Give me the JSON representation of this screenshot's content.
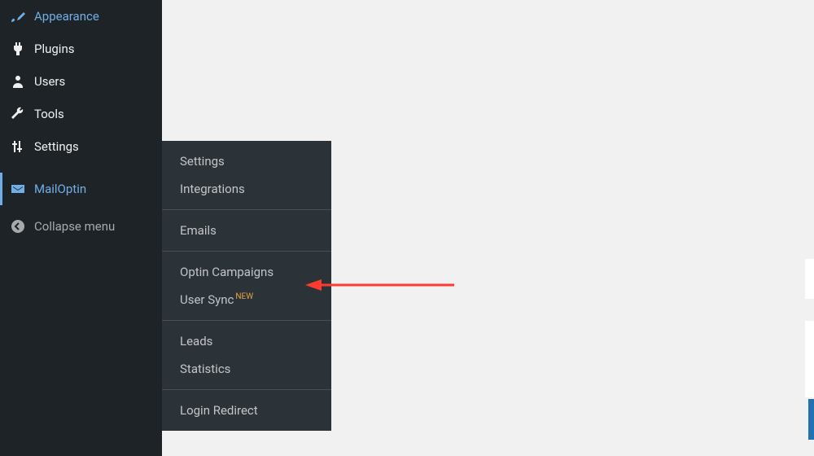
{
  "sidebar": {
    "items": [
      {
        "label": "Appearance"
      },
      {
        "label": "Plugins"
      },
      {
        "label": "Users"
      },
      {
        "label": "Tools"
      },
      {
        "label": "Settings"
      },
      {
        "label": "MailOptin"
      }
    ],
    "collapse_label": "Collapse menu"
  },
  "submenu": {
    "groups": [
      {
        "items": [
          {
            "label": "Settings"
          },
          {
            "label": "Integrations"
          }
        ]
      },
      {
        "items": [
          {
            "label": "Emails"
          }
        ]
      },
      {
        "items": [
          {
            "label": "Optin Campaigns"
          },
          {
            "label": "User Sync",
            "badge": "NEW"
          }
        ]
      },
      {
        "items": [
          {
            "label": "Leads"
          },
          {
            "label": "Statistics"
          }
        ]
      },
      {
        "items": [
          {
            "label": "Login Redirect"
          }
        ]
      }
    ]
  }
}
